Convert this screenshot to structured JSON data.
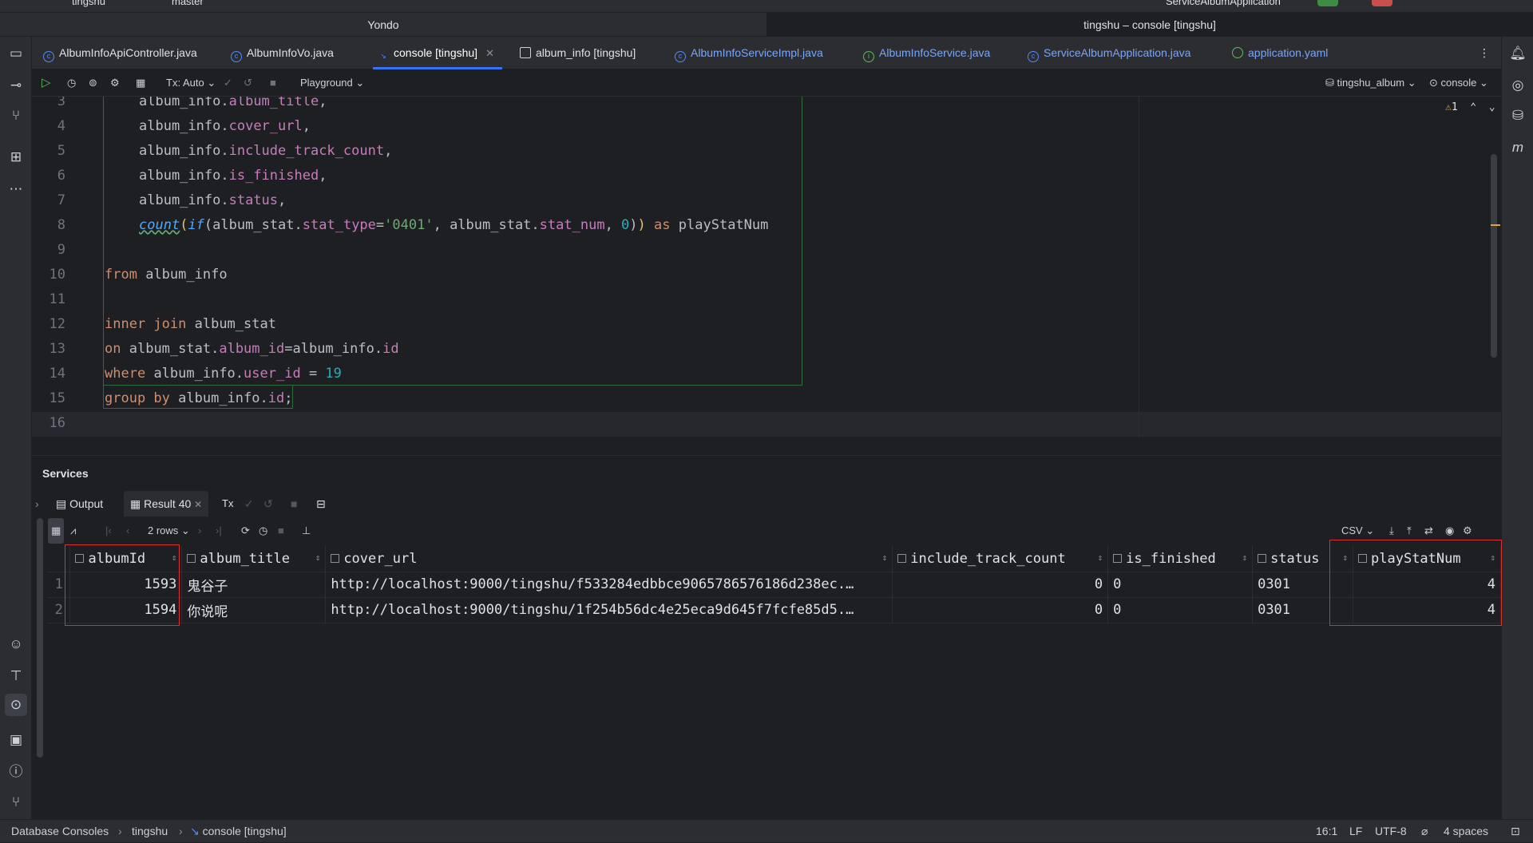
{
  "titlebar": {
    "project": "tingshu",
    "branch": "master",
    "run_config": "ServiceAlbumApplication"
  },
  "window_tabs": [
    "Yondo",
    "tingshu – console [tingshu]"
  ],
  "editor_tabs": [
    {
      "label": "AlbumInfoApiController.java"
    },
    {
      "label": "AlbumInfoVo.java"
    },
    {
      "label": "console [tingshu]"
    },
    {
      "label": "album_info [tingshu]"
    },
    {
      "label": "AlbumInfoServiceImpl.java"
    },
    {
      "label": "AlbumInfoService.java"
    },
    {
      "label": "ServiceAlbumApplication.java"
    },
    {
      "label": "application.yaml"
    }
  ],
  "toolbar": {
    "tx": "Tx: Auto",
    "playground": "Playground",
    "datasource": "tingshu_album",
    "session": "console"
  },
  "editor": {
    "warning_count": "1",
    "line_numbers": [
      "3",
      "4",
      "5",
      "6",
      "7",
      "8",
      "9",
      "10",
      "11",
      "12",
      "13",
      "14",
      "15",
      "16"
    ],
    "code": {
      "l3_obj": "album_info",
      "l3_fld": "album_title",
      "l4_obj": "album_info",
      "l4_fld": "cover_url",
      "l5_obj": "album_info",
      "l5_fld": "include_track_count",
      "l6_obj": "album_info",
      "l6_fld": "is_finished",
      "l7_obj": "album_info",
      "l7_fld": "status",
      "l8_count": "count",
      "l8_if": "if",
      "l8_obj": "album_stat",
      "l8_fld": "stat_type",
      "l8_str": "'0401'",
      "l8_obj2": "album_stat",
      "l8_fld2": "stat_num",
      "l8_zero": "0",
      "l8_as": "as",
      "l8_alias": "playStatNum",
      "l10_kw": "from",
      "l10_tbl": "album_info",
      "l12_kw": "inner join",
      "l12_tbl": "album_stat",
      "l13_kw": "on",
      "l13_obj": "album_stat",
      "l13_fld": "album_id",
      "l13_obj2": "album_info",
      "l13_fld2": "id",
      "l14_kw": "where",
      "l14_obj": "album_info",
      "l14_fld": "user_id",
      "l14_num": "19",
      "l15_kw": "group by",
      "l15_obj": "album_info",
      "l15_fld": "id"
    }
  },
  "services": {
    "title": "Services",
    "tabs": {
      "output": "Output",
      "result": "Result 40",
      "tx": "Tx"
    },
    "rows_label": "2 rows",
    "export_format": "CSV",
    "columns": [
      "albumId",
      "album_title",
      "cover_url",
      "include_track_count",
      "is_finished",
      "status",
      "playStatNum"
    ],
    "rows": [
      {
        "n": "1",
        "albumId": "1593",
        "album_title": "鬼谷子",
        "cover_url": "http://localhost:9000/tingshu/f533284edbbce9065786576186d238ec.…",
        "include_track_count": "0",
        "is_finished": "0",
        "status": "0301",
        "playStatNum": "4"
      },
      {
        "n": "2",
        "albumId": "1594",
        "album_title": "你说呢",
        "cover_url": "http://localhost:9000/tingshu/1f254b56dc4e25eca9d645f7fcfe85d5.…",
        "include_track_count": "0",
        "is_finished": "0",
        "status": "0301",
        "playStatNum": "4"
      }
    ]
  },
  "statusbar": {
    "breadcrumb": [
      "Database Consoles",
      "tingshu",
      "console [tingshu]"
    ],
    "position": "16:1",
    "line_ending": "LF",
    "encoding": "UTF-8",
    "indent": "4 spaces"
  },
  "colors": {
    "accent": "#3574f0",
    "highlight_box": "#d8302f",
    "keyword": "#cf8e6d",
    "field": "#c77dbb",
    "string": "#6aab73",
    "number": "#2aacb8"
  }
}
